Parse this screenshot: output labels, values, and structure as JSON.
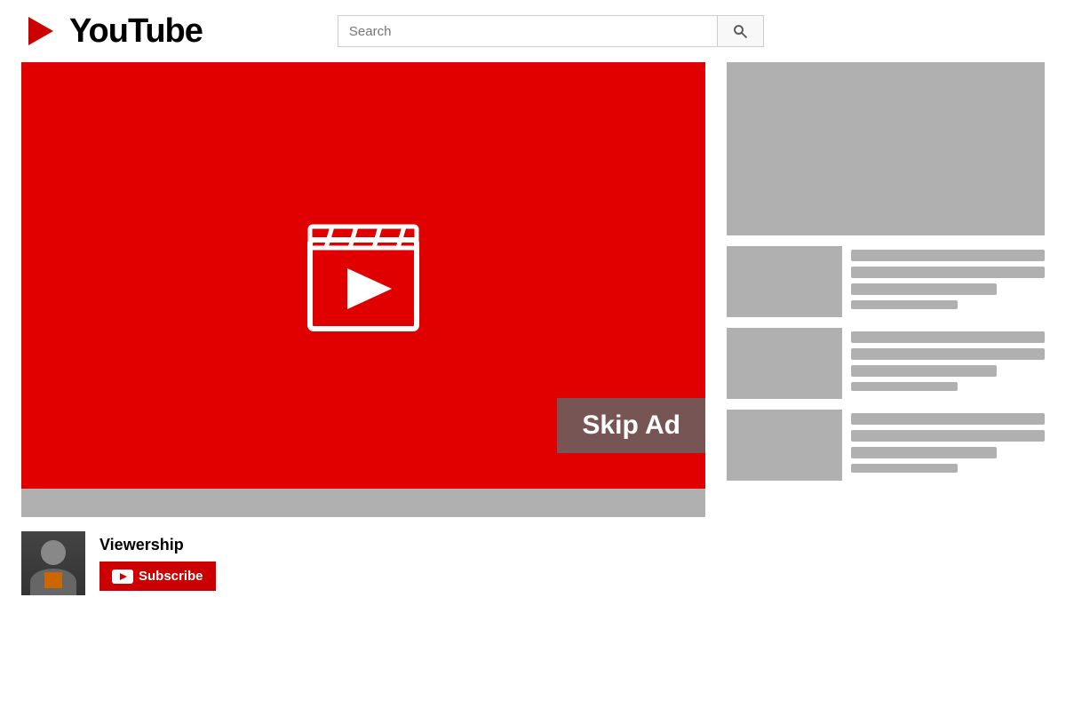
{
  "header": {
    "logo_text": "YouTube",
    "search_placeholder": "Search"
  },
  "video": {
    "skip_ad_label": "Skip Ad",
    "progress_bar_color": "#b0b0b0"
  },
  "channel": {
    "name": "Viewership",
    "subscribe_label": "Subscribe"
  },
  "related": [
    {
      "id": 1
    },
    {
      "id": 2
    },
    {
      "id": 3
    }
  ],
  "icons": {
    "search": "🔍",
    "play": "▶"
  }
}
